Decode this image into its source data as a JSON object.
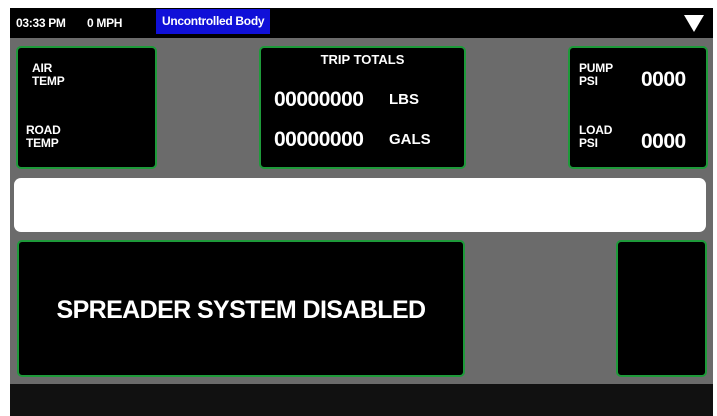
{
  "status_bar": {
    "time": "03:33 PM",
    "speed": "0 MPH",
    "mode": "Uncontrolled Body",
    "mode_color": "#1010d8",
    "menu_icon": "triangle-down-icon"
  },
  "temps": {
    "air_label_1": "AIR",
    "air_label_2": "TEMP",
    "road_label_1": "ROAD",
    "road_label_2": "TEMP"
  },
  "trip_totals": {
    "title": "TRIP TOTALS",
    "lbs_value": "00000000",
    "lbs_unit": "LBS",
    "gals_value": "00000000",
    "gals_unit": "GALS"
  },
  "psi": {
    "pump_label_1": "PUMP",
    "pump_label_2": "PSI",
    "pump_value": "0000",
    "load_label_1": "LOAD",
    "load_label_2": "PSI",
    "load_value": "0000"
  },
  "message": "",
  "status": {
    "text": "SPREADER SYSTEM DISABLED"
  },
  "colors": {
    "panel_border": "#1e9a3a",
    "background": "#6b6b6b",
    "panel": "#000000"
  }
}
